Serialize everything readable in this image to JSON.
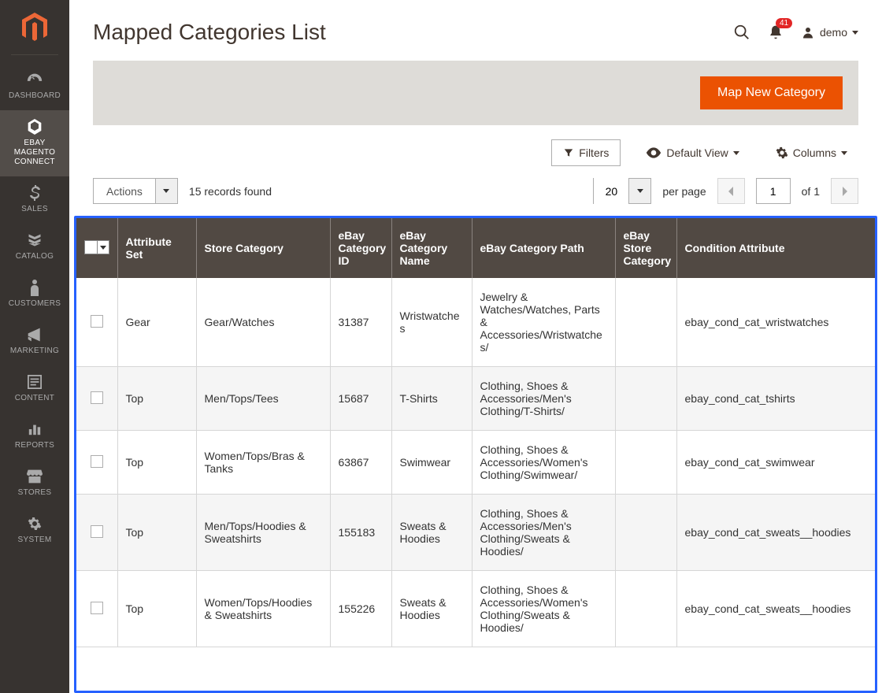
{
  "sidebar": {
    "items": [
      {
        "label": "DASHBOARD",
        "icon": "dashboard"
      },
      {
        "label": "EBAY MAGENTO CONNECT",
        "icon": "connect",
        "active": true
      },
      {
        "label": "SALES",
        "icon": "sales"
      },
      {
        "label": "CATALOG",
        "icon": "catalog"
      },
      {
        "label": "CUSTOMERS",
        "icon": "customers"
      },
      {
        "label": "MARKETING",
        "icon": "marketing"
      },
      {
        "label": "CONTENT",
        "icon": "content"
      },
      {
        "label": "REPORTS",
        "icon": "reports"
      },
      {
        "label": "STORES",
        "icon": "stores"
      },
      {
        "label": "SYSTEM",
        "icon": "system"
      }
    ]
  },
  "header": {
    "title": "Mapped Categories List",
    "notification_count": "41",
    "user_name": "demo"
  },
  "action_bar": {
    "primary_button": "Map New Category"
  },
  "toolbar": {
    "filters": "Filters",
    "default_view": "Default View",
    "columns": "Columns"
  },
  "toolbar2": {
    "actions_label": "Actions",
    "records_found": "15 records found",
    "per_page_value": "20",
    "per_page_label": "per page",
    "page_value": "1",
    "of_label": "of 1"
  },
  "table": {
    "columns": [
      "",
      "Attribute Set",
      "Store Category",
      "eBay Category ID",
      "eBay Category Name",
      "eBay Category Path",
      "eBay Store Category",
      "Condition Attribute"
    ],
    "rows": [
      {
        "attr_set": "Gear",
        "store_cat": "Gear/Watches",
        "ebay_id": "31387",
        "ebay_name": "Wristwatches",
        "ebay_path": "Jewelry & Watches/Watches, Parts & Accessories/Wristwatches/",
        "ebay_store": "",
        "condition": "ebay_cond_cat_wristwatches"
      },
      {
        "attr_set": "Top",
        "store_cat": "Men/Tops/Tees",
        "ebay_id": "15687",
        "ebay_name": "T-Shirts",
        "ebay_path": "Clothing, Shoes & Accessories/Men's Clothing/T-Shirts/",
        "ebay_store": "",
        "condition": "ebay_cond_cat_tshirts"
      },
      {
        "attr_set": "Top",
        "store_cat": "Women/Tops/Bras & Tanks",
        "ebay_id": "63867",
        "ebay_name": "Swimwear",
        "ebay_path": "Clothing, Shoes & Accessories/Women's Clothing/Swimwear/",
        "ebay_store": "",
        "condition": "ebay_cond_cat_swimwear"
      },
      {
        "attr_set": "Top",
        "store_cat": "Men/Tops/Hoodies & Sweatshirts",
        "ebay_id": "155183",
        "ebay_name": "Sweats & Hoodies",
        "ebay_path": "Clothing, Shoes & Accessories/Men's Clothing/Sweats & Hoodies/",
        "ebay_store": "",
        "condition": "ebay_cond_cat_sweats__hoodies"
      },
      {
        "attr_set": "Top",
        "store_cat": "Women/Tops/Hoodies & Sweatshirts",
        "ebay_id": "155226",
        "ebay_name": "Sweats & Hoodies",
        "ebay_path": "Clothing, Shoes & Accessories/Women's Clothing/Sweats & Hoodies/",
        "ebay_store": "",
        "condition": "ebay_cond_cat_sweats__hoodies"
      }
    ]
  }
}
